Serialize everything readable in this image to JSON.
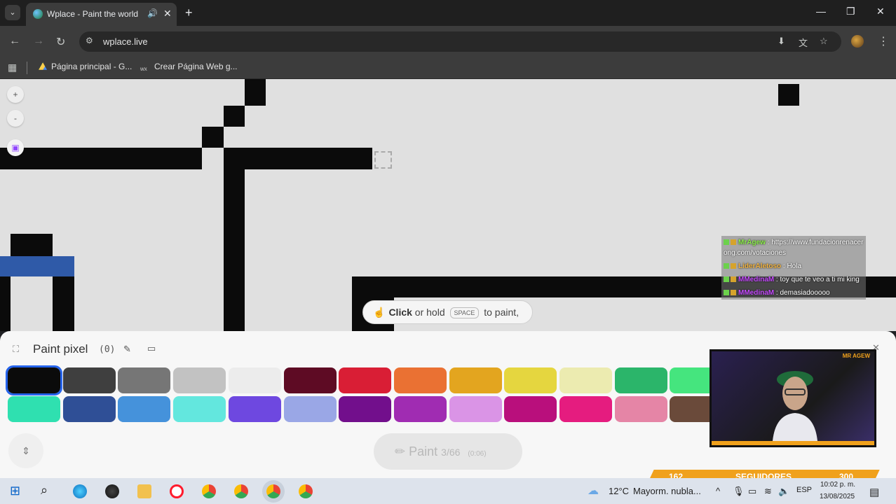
{
  "browser": {
    "tab_title": "Wplace - Paint the world",
    "url": "wplace.live",
    "bookmarks": [
      "Página principal - G...",
      "Crear Página Web g..."
    ]
  },
  "canvas": {
    "zoom_in": "+",
    "zoom_out": "-",
    "hint_bold": "Click",
    "hint_mid": "or hold",
    "hint_key": "SPACE",
    "hint_end": "to paint,"
  },
  "chat": [
    {
      "user": "MrAgew",
      "text": ": https://www.fundacionrenacerong.com/votaciones",
      "color": "#8ef04b"
    },
    {
      "user": "LiderAletoso",
      "text": ": Hola",
      "color": "#f2b441"
    },
    {
      "user": "MMedinaM",
      "text": ": toy que te veo a ti mi king",
      "color": "#c64bff"
    },
    {
      "user": "MMedinaM",
      "text": ": demasiadooooo",
      "color": "#c64bff"
    }
  ],
  "panel": {
    "title": "Paint pixel",
    "count": "(0)",
    "paint_label": "Paint",
    "charges": "3/66",
    "timer": "(0:06)"
  },
  "palette_row1": [
    "#0b0b0b",
    "#3f3f3f",
    "#767676",
    "#c2c2c2",
    "#ececec",
    "#5e0b24",
    "#d91e35",
    "#ea7133",
    "#e3a51f",
    "#e5d63f",
    "#ecebb0",
    "#2bb56a",
    "#45e57e"
  ],
  "palette_row2": [
    "#2fe0b0",
    "#2f4f96",
    "#4592db",
    "#63e7de",
    "#6e48e0",
    "#9aa7e6",
    "#720f8c",
    "#a02cb2",
    "#da94e6",
    "#b90f7c",
    "#e51c7f",
    "#e585a6",
    "#6a4a3a"
  ],
  "stream": {
    "name": "MR AGEW",
    "followers_current": "162",
    "followers_label": "SEGUIDORES",
    "followers_goal": "300"
  },
  "taskbar": {
    "weather_temp": "12°C",
    "weather_desc": "Mayorm. nubla...",
    "lang": "ESP",
    "time": "10:02 p. m.",
    "date": "13/08/2025"
  }
}
